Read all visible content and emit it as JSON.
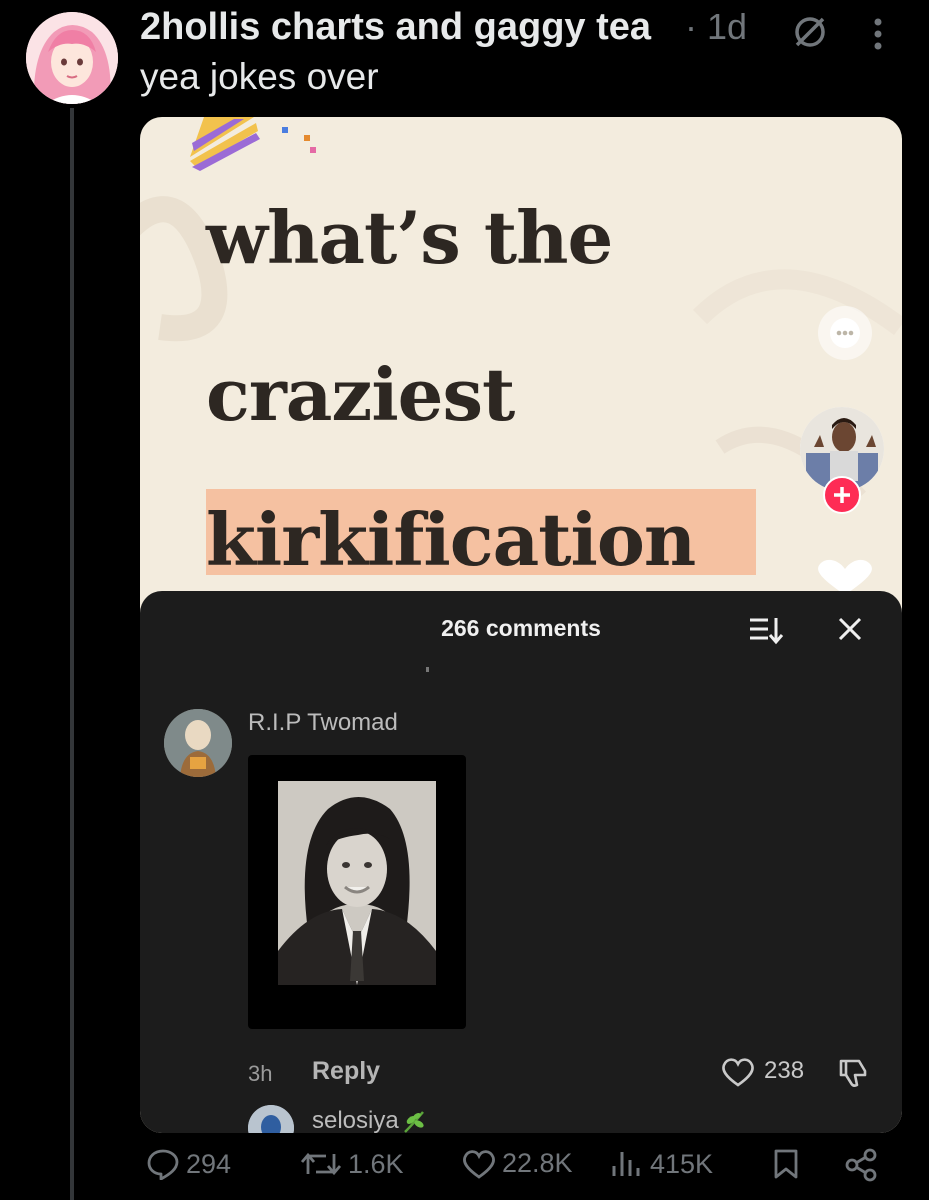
{
  "post": {
    "author": "2hollis charts and gaggy tea",
    "time": "1d",
    "separator": "·",
    "text": "yea jokes over"
  },
  "slide": {
    "lines": [
      "what’s the",
      "craziest",
      "kirkification"
    ],
    "highlight_color": "#f5c1a1"
  },
  "comments_panel": {
    "title": "266 comments",
    "comment": {
      "username": "R.I.P Twomad",
      "time": "3h",
      "reply_label": "Reply",
      "likes": "238"
    },
    "next_username": "selosiya"
  },
  "actions": {
    "replies": "294",
    "reposts": "1.6K",
    "likes": "22.8K",
    "views": "415K"
  },
  "icons": [
    "no-reply-icon",
    "more-icon",
    "comment-bubble-icon",
    "creator-avatar",
    "follow-plus-icon",
    "heart-icon",
    "sort-icon",
    "close-icon",
    "dislike-icon",
    "reply-icon",
    "repost-icon",
    "views-icon",
    "bookmark-icon",
    "share-icon"
  ],
  "colors": {
    "background": "#000000",
    "text": "#e7e9ea",
    "muted": "#71767b",
    "follow": "#fe2c55",
    "panel": "#1c1c1c"
  }
}
